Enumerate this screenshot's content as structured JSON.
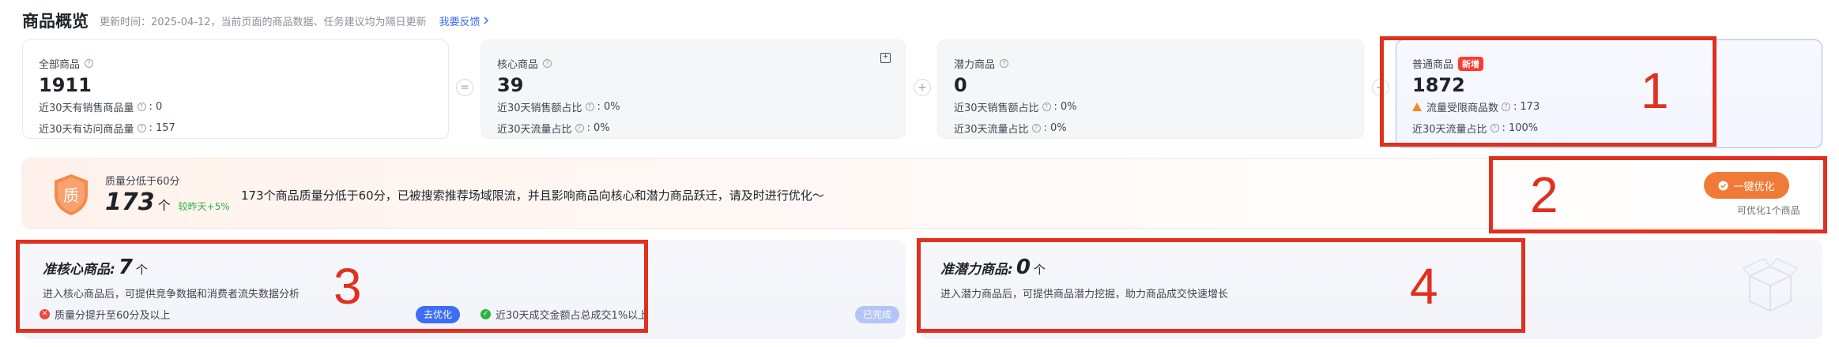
{
  "header": {
    "title": "商品概览",
    "update_text": "更新时间：2025-04-12，当前页面的商品数据、任务建议均为隔日更新",
    "feedback_label": "我要反馈"
  },
  "cards": {
    "all": {
      "label": "全部商品",
      "value": "1911",
      "row1_label": "近30天有销售商品量",
      "row1_value": "0",
      "row2_label": "近30天有访问商品量",
      "row2_value": "157"
    },
    "core": {
      "label": "核心商品",
      "value": "39",
      "row1_label": "近30天销售额占比",
      "row1_value": "0%",
      "row2_label": "近30天流量占比",
      "row2_value": "0%"
    },
    "potential": {
      "label": "潜力商品",
      "value": "0",
      "row1_label": "近30天销售额占比",
      "row1_value": "0%",
      "row2_label": "近30天流量占比",
      "row2_value": "0%"
    },
    "normal": {
      "label": "普通商品",
      "badge": "新增",
      "value": "1872",
      "row1_label": "流量受限商品数",
      "row1_value": "173",
      "row2_label": "近30天流量占比",
      "row2_value": "100%"
    },
    "operators": [
      "=",
      "+",
      "+"
    ]
  },
  "quality": {
    "shield_char": "质",
    "label": "质量分低于60分",
    "count": "173",
    "unit": "个",
    "delta": "较昨天+5%",
    "description": "173个商品质量分低于60分，已被搜索推荐场域限流，并且影响商品向核心和潜力商品跃迁，请及时进行优化～",
    "button_label": "一键优化",
    "note": "可优化1个商品"
  },
  "panels": {
    "quasi_core": {
      "title": "准核心商品:",
      "count": "7",
      "unit": "个",
      "description": "进入核心商品后，可提供竞争数据和消费者流失数据分析",
      "cond1": "质量分提升至60分及以上",
      "cond1_action": "去优化",
      "cond2": "近30天成交金额占总成交1%以上",
      "cond2_action": "已完成"
    },
    "quasi_potential": {
      "title": "准潜力商品:",
      "count": "0",
      "unit": "个",
      "description": "进入潜力商品后，可提供商品潜力挖掘，助力商品成交快速增长"
    }
  },
  "annotations": [
    "1",
    "2",
    "3",
    "4"
  ],
  "colors": {
    "accent_blue": "#3b6df5",
    "accent_orange": "#f07b38",
    "annotation_red": "#e0301e",
    "success_green": "#2fb344"
  }
}
